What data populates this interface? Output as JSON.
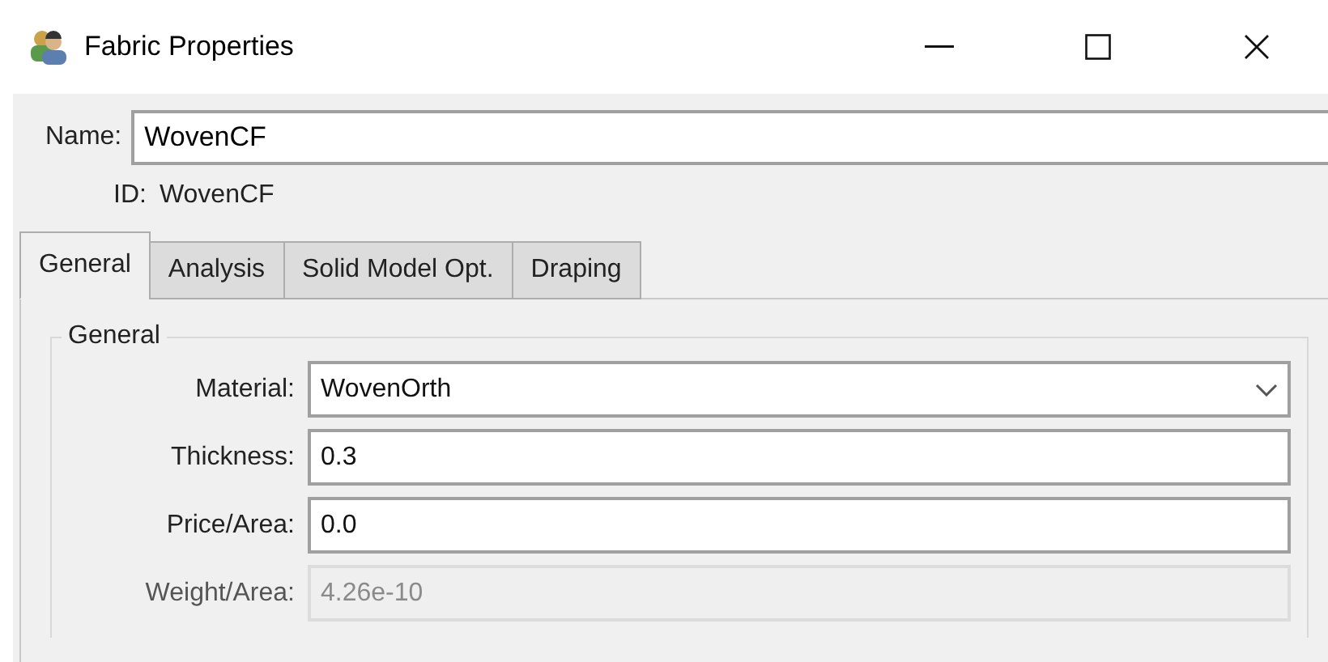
{
  "window": {
    "title": "Fabric Properties"
  },
  "name_field": {
    "label": "Name:",
    "value": "WovenCF"
  },
  "id_field": {
    "label": "ID:",
    "value": "WovenCF"
  },
  "tabs": [
    {
      "label": "General",
      "selected": true
    },
    {
      "label": "Analysis",
      "selected": false
    },
    {
      "label": "Solid Model Opt.",
      "selected": false
    },
    {
      "label": "Draping",
      "selected": false
    }
  ],
  "group": {
    "title": "General",
    "fields": [
      {
        "kind": "dropdown",
        "label": "Material:",
        "value": "WovenOrth",
        "disabled": false
      },
      {
        "kind": "text",
        "label": "Thickness:",
        "value": "0.3",
        "disabled": false
      },
      {
        "kind": "text",
        "label": "Price/Area:",
        "value": "0.0",
        "disabled": false
      },
      {
        "kind": "text",
        "label": "Weight/Area:",
        "value": "4.26e-10",
        "disabled": true
      }
    ]
  }
}
